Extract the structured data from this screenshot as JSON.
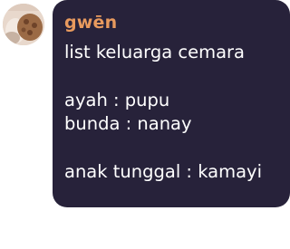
{
  "message": {
    "author": "gwēn",
    "lines": [
      "list keluarga cemara",
      "ayah : pupu",
      "bunda : nanay",
      "anak tunggal : kamayi"
    ]
  },
  "colors": {
    "bubble": "#27223a",
    "author": "#e89a5e",
    "text": "#ffffff",
    "page": "#ffffff"
  }
}
